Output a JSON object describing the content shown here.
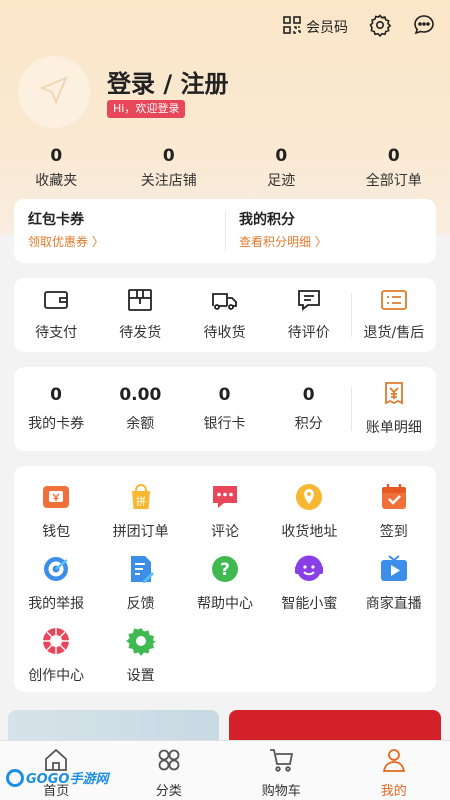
{
  "topbar": {
    "member_code_label": "会员码"
  },
  "profile": {
    "login_title": "登录 / 注册",
    "welcome": "Hi，欢迎登录"
  },
  "stats": [
    {
      "value": "0",
      "label": "收藏夹"
    },
    {
      "value": "0",
      "label": "关注店铺"
    },
    {
      "value": "0",
      "label": "足迹"
    },
    {
      "value": "0",
      "label": "全部订单"
    }
  ],
  "coupons": {
    "left": {
      "title": "红包卡券",
      "sub": "领取优惠券 〉"
    },
    "right": {
      "title": "我的积分",
      "sub": "查看积分明细 〉"
    }
  },
  "orders": [
    {
      "label": "待支付",
      "icon": "wallet-icon"
    },
    {
      "label": "待发货",
      "icon": "package-icon"
    },
    {
      "label": "待收货",
      "icon": "delivery-truck-icon"
    },
    {
      "label": "待评价",
      "icon": "comment-icon"
    },
    {
      "label": "退货/售后",
      "icon": "refund-list-icon"
    }
  ],
  "wallet": [
    {
      "value": "0",
      "label": "我的卡券"
    },
    {
      "value": "0.00",
      "label": "余额"
    },
    {
      "value": "0",
      "label": "银行卡"
    },
    {
      "value": "0",
      "label": "积分"
    }
  ],
  "bill_label": "账单明细",
  "services": [
    {
      "label": "钱包",
      "icon": "wallet-orange-icon"
    },
    {
      "label": "拼团订单",
      "icon": "group-buy-icon",
      "badge": "拼"
    },
    {
      "label": "评论",
      "icon": "comment-bubble-icon"
    },
    {
      "label": "收货地址",
      "icon": "location-pin-icon"
    },
    {
      "label": "签到",
      "icon": "calendar-check-icon"
    },
    {
      "label": "我的举报",
      "icon": "target-icon"
    },
    {
      "label": "反馈",
      "icon": "feedback-doc-icon"
    },
    {
      "label": "帮助中心",
      "icon": "help-icon",
      "badge": "?"
    },
    {
      "label": "智能小蜜",
      "icon": "assistant-smile-icon"
    },
    {
      "label": "商家直播",
      "icon": "live-tv-icon"
    },
    {
      "label": "创作中心",
      "icon": "camera-shutter-icon"
    },
    {
      "label": "设置",
      "icon": "gear-icon"
    }
  ],
  "tabs": [
    {
      "label": "首页",
      "icon": "home-icon"
    },
    {
      "label": "分类",
      "icon": "category-icon"
    },
    {
      "label": "购物车",
      "icon": "cart-icon"
    },
    {
      "label": "我的",
      "icon": "profile-icon"
    }
  ],
  "watermark": "GOGO手游网",
  "colors": {
    "accent": "#e8671e",
    "badge": "#e8475a",
    "header_bg": "#fbe6c8"
  }
}
